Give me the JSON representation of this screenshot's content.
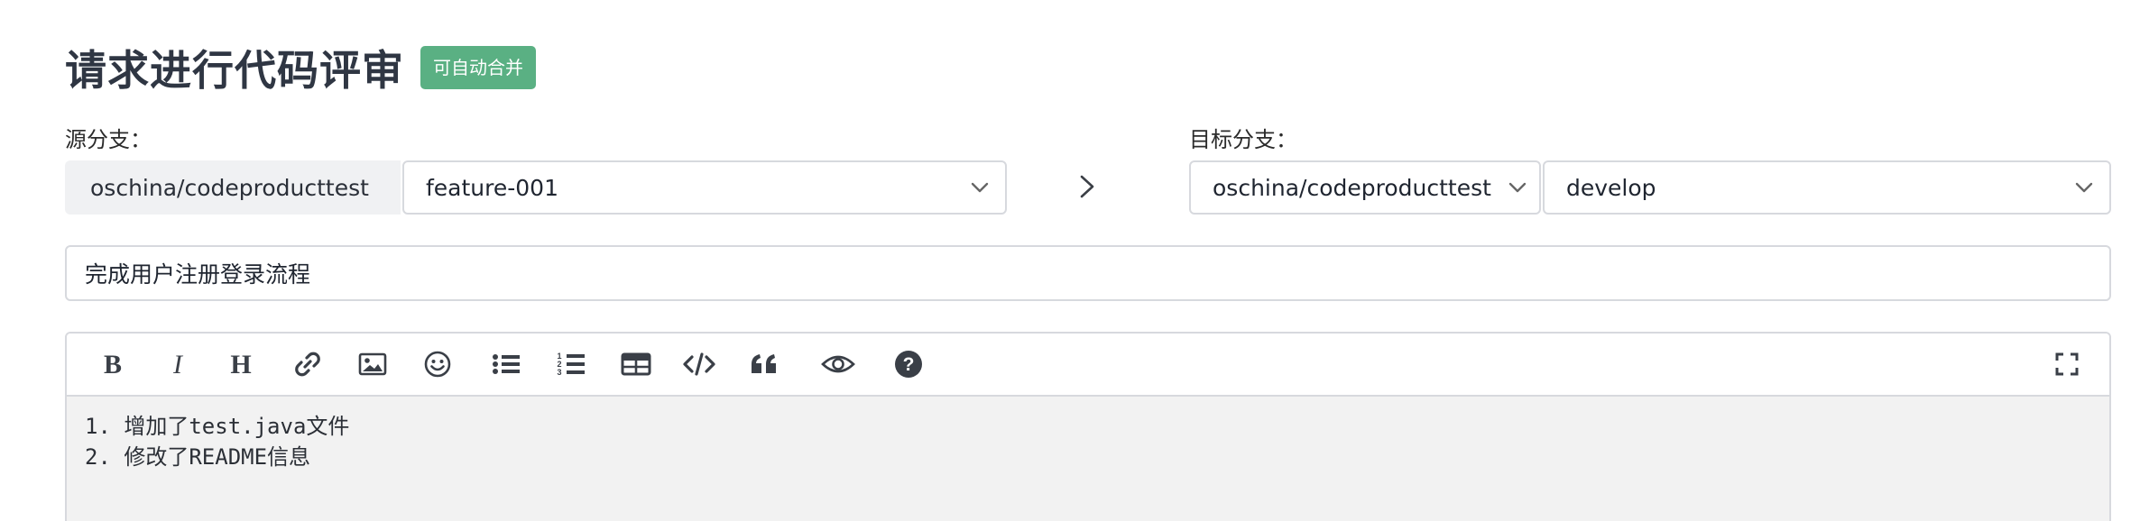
{
  "page": {
    "title": "请求进行代码评审",
    "badge": "可自动合并"
  },
  "source": {
    "label": "源分支：",
    "repo": "oschina/codeproducttest",
    "branch": "feature-001"
  },
  "target": {
    "label": "目标分支：",
    "repo": "oschina/codeproducttest",
    "branch": "develop"
  },
  "pr_title": "完成用户注册登录流程",
  "editor": {
    "toolbar": [
      "bold-icon",
      "italic-icon",
      "heading-icon",
      "link-icon",
      "image-icon",
      "emoji-icon",
      "bullet-list-icon",
      "numbered-list-icon",
      "table-icon",
      "code-icon",
      "quote-icon",
      "preview-icon",
      "help-icon",
      "fullscreen-icon"
    ],
    "lines": [
      "1. 增加了test.java文件",
      "2. 修改了README信息"
    ]
  },
  "colors": {
    "badge": "#5ab083",
    "title": "#2f3643",
    "border": "#d7d9de",
    "repo_bg": "#f0f1f3",
    "editor_bg": "#f2f2f2"
  }
}
